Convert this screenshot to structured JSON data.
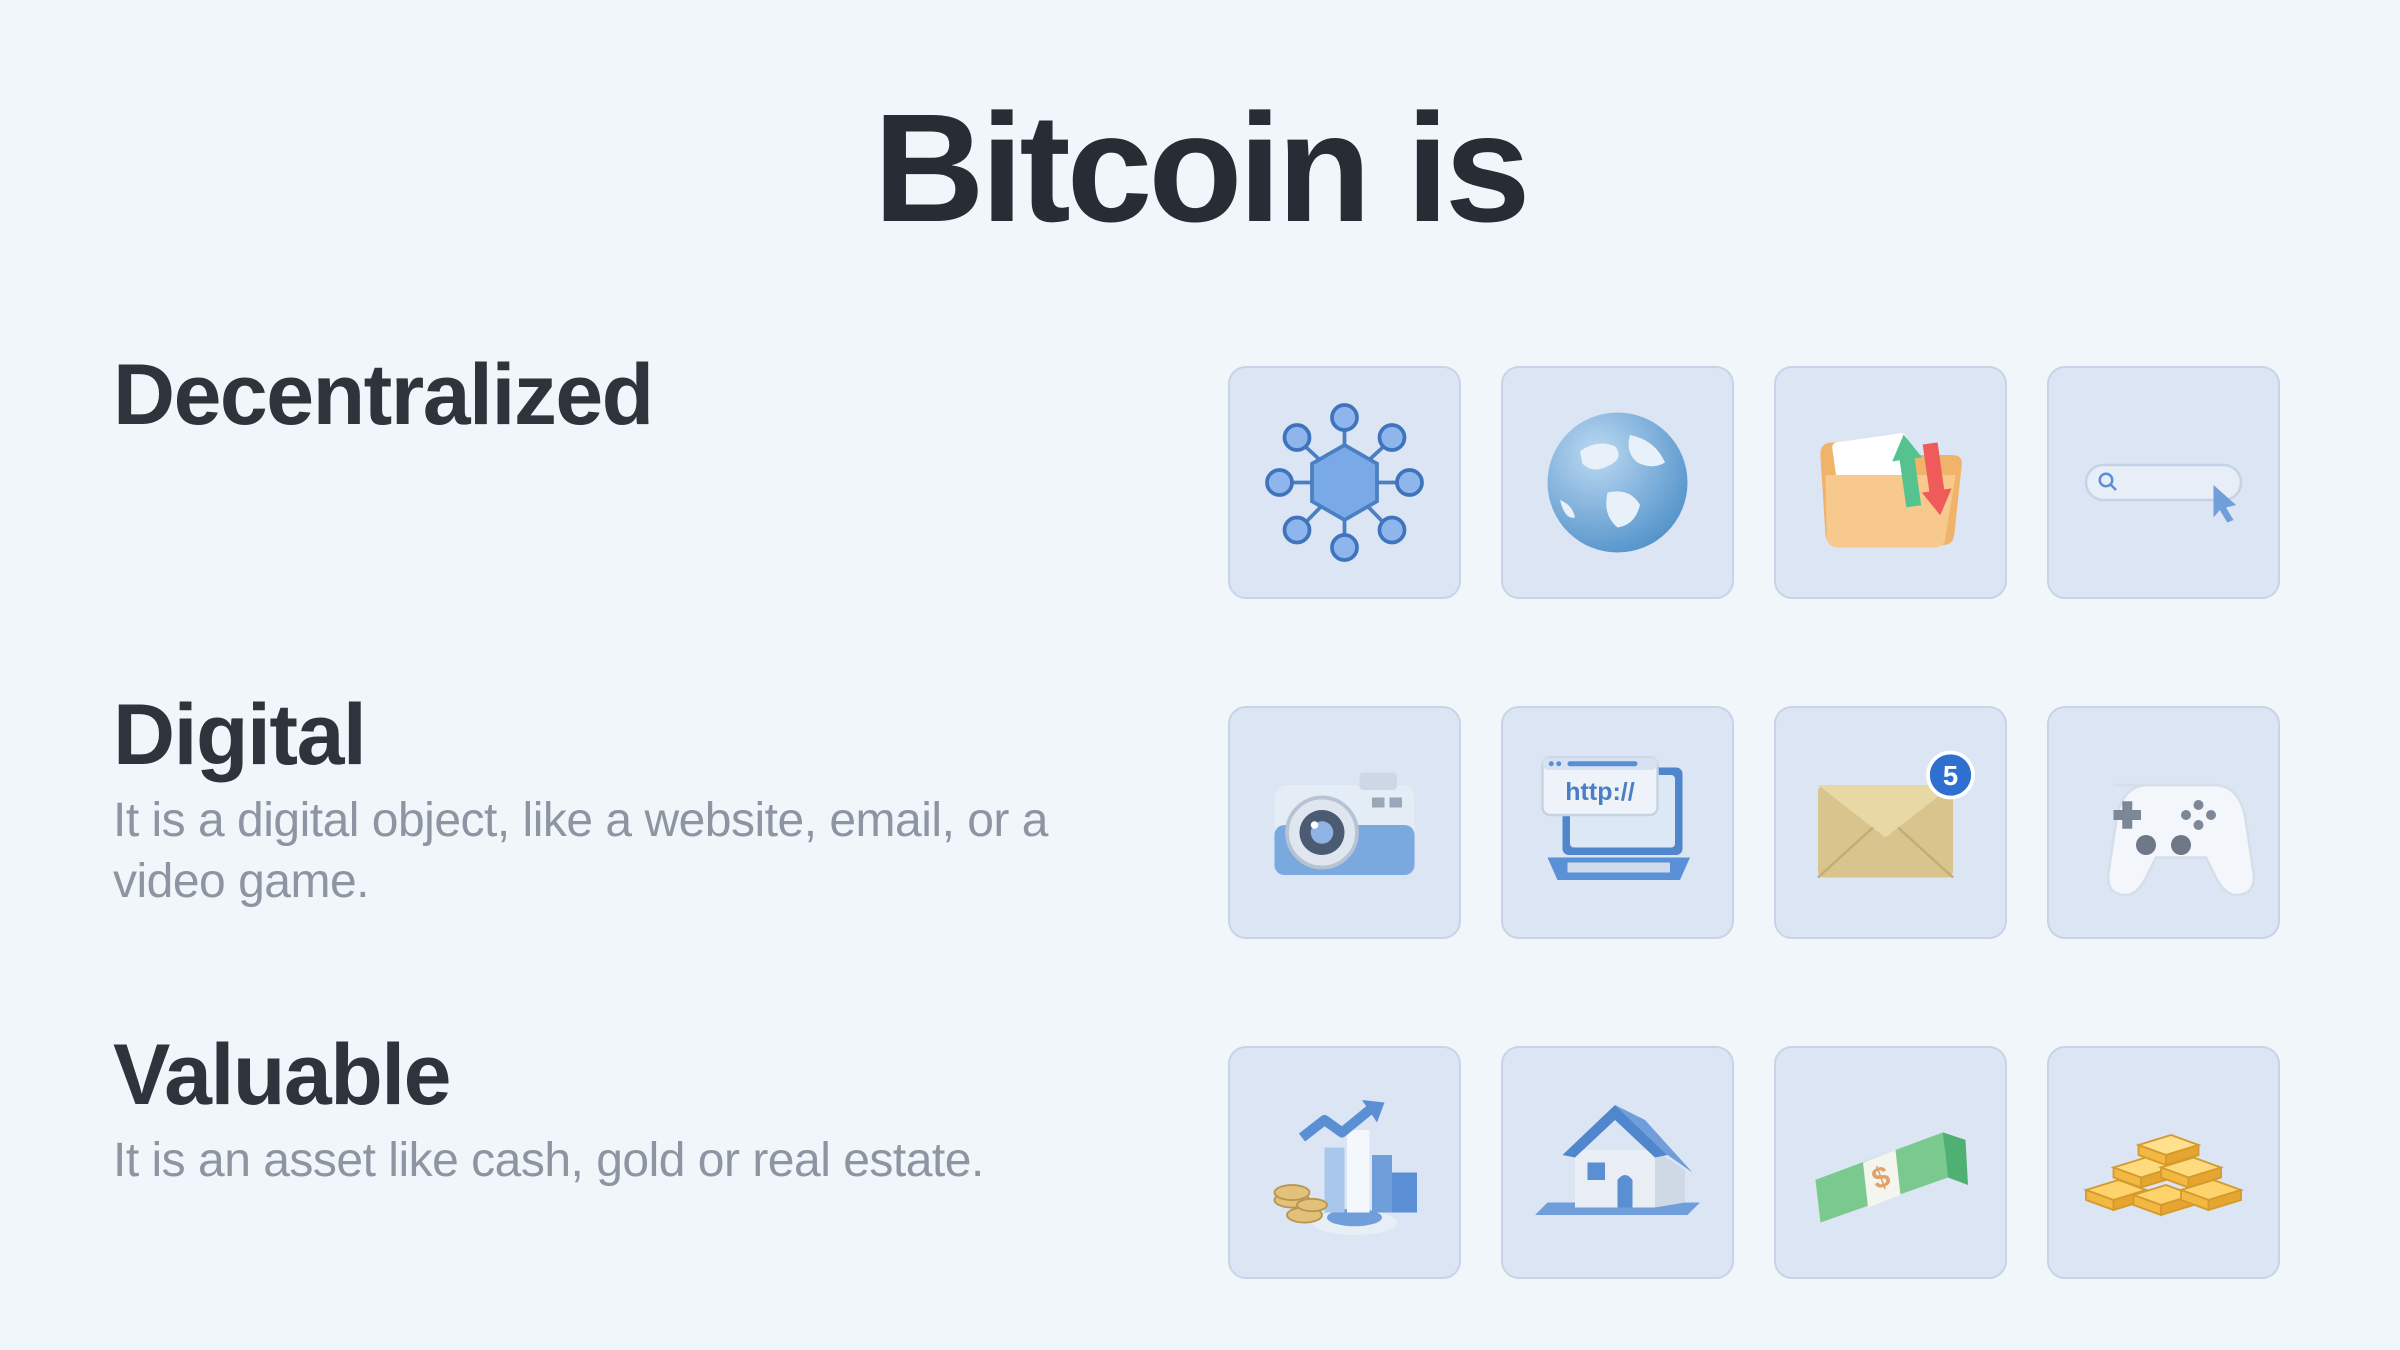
{
  "title": "Bitcoin is",
  "sections": [
    {
      "heading": "Decentralized",
      "description": ""
    },
    {
      "heading": "Digital",
      "description": "It is a digital object, like a website, email, or a video game."
    },
    {
      "heading": "Valuable",
      "description": "It is an asset like cash, gold or real estate."
    }
  ],
  "tiles": {
    "decentralized": [
      "network-icon",
      "globe-icon",
      "folder-transfer-icon",
      "search-bar-icon"
    ],
    "digital": [
      "camera-icon",
      "laptop-icon",
      "email-icon",
      "game-controller-icon"
    ],
    "valuable": [
      "growth-chart-icon",
      "house-icon",
      "cash-icon",
      "gold-bars-icon"
    ]
  },
  "laptop_text": "http://",
  "email_badge_count": "5",
  "cash_symbol": "$",
  "colors": {
    "background": "#f1f6fb",
    "tile": "#dbe5f4",
    "heading": "#2f343c",
    "body_text": "#8d95a2",
    "accent_blue": "#6f9edb"
  }
}
